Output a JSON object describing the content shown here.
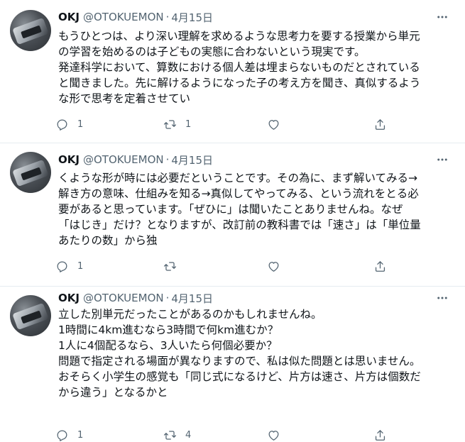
{
  "tweets": [
    {
      "name": "OKJ",
      "handle": "@OTOKUEMON",
      "separator": "·",
      "date": "4月15日",
      "lines": [
        "もうひとつは、より深い理解を求めるような思考力を要する授業から単元",
        "の学習を始めるのは子どもの実態に合わないという現実です。",
        "発達科学において、算数における個人差は埋まらないものだとされている",
        "と聞きました。先に解けるようになった子の考え方を聞き、真似するよう",
        "な形で思考を定着させてい"
      ],
      "reply_count": "1",
      "retweet_count": "1",
      "like_count": ""
    },
    {
      "name": "OKJ",
      "handle": "@OTOKUEMON",
      "separator": "·",
      "date": "4月15日",
      "lines": [
        "くような形が時には必要だということです。その為に、まず解いてみる→",
        "解き方の意味、仕組みを知る→真似してやってみる、という流れをとる必",
        "要があると思っています。「ぜひに」は聞いたことありませんね。なぜ",
        "「はじき」だけ？となりますが、改訂前の教科書では「速さ」は「単位量",
        "あたりの数」から独"
      ],
      "reply_count": "1",
      "retweet_count": "",
      "like_count": ""
    },
    {
      "name": "OKJ",
      "handle": "@OTOKUEMON",
      "separator": "·",
      "date": "4月15日",
      "lines": [
        "立した別単元だったことがあるのかもしれませんね。",
        "",
        "1時間に4km進むなら3時間で何km進むか？",
        "1人に4個配るなら、3人いたら何個必要か？",
        "問題で指定される場面が異なりますので、私は似た問題とは思いません。",
        "おそらく小学生の感覚も「同じ式になるけど、片方は速さ、片方は個数だ",
        "から違う」となるかと"
      ],
      "reply_count": "1",
      "retweet_count": "4",
      "like_count": ""
    }
  ],
  "icons": {
    "more": "more-horizontal-icon",
    "reply": "reply-icon",
    "retweet": "retweet-icon",
    "like": "heart-icon",
    "share": "share-icon"
  },
  "colors": {
    "text": "#0f1419",
    "secondary": "#536471",
    "border": "#e6ecf0"
  }
}
